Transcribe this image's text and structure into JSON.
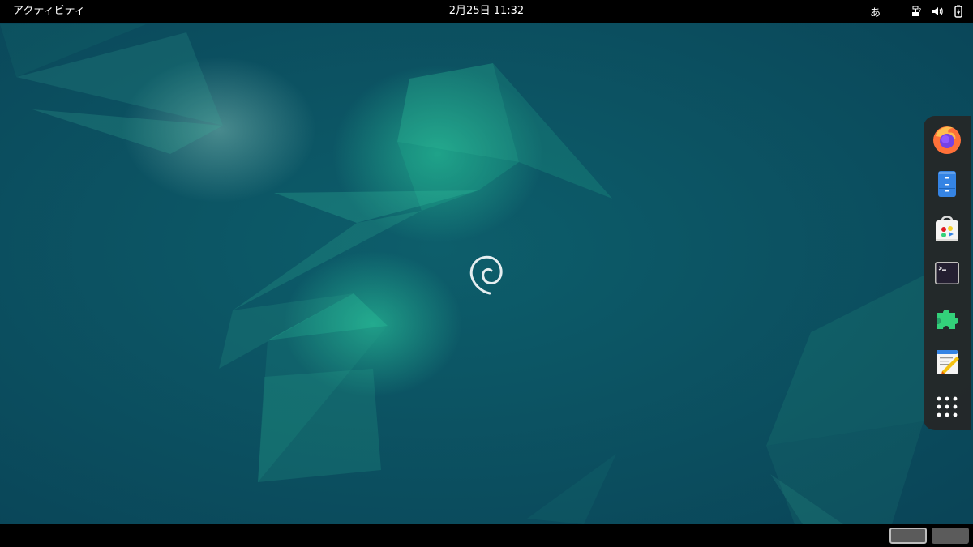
{
  "topbar": {
    "activities_label": "アクティビティ",
    "clock": "2月25日  11:32",
    "ime_label": "あ",
    "icons": [
      "network-wired-question-icon",
      "volume-icon",
      "battery-icon"
    ]
  },
  "dash": {
    "apps": [
      {
        "name": "firefox-icon"
      },
      {
        "name": "files-icon"
      },
      {
        "name": "software-center-icon"
      },
      {
        "name": "terminal-icon"
      },
      {
        "name": "extensions-icon"
      },
      {
        "name": "text-editor-icon"
      },
      {
        "name": "show-apps-grid-icon"
      }
    ]
  },
  "workspaces": {
    "count": 2,
    "active_index": 0
  },
  "colors": {
    "panel": "#000000",
    "wallpaper_base": "#0b4d5e",
    "accent_teal": "#17a58a",
    "dash_bg": "#262626"
  }
}
